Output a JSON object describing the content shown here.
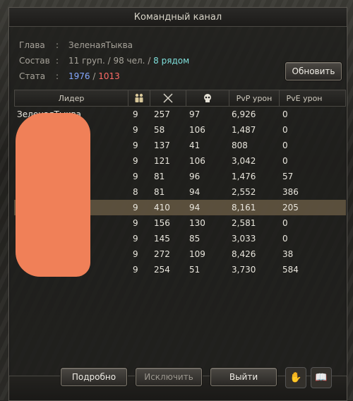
{
  "window": {
    "title": "Командный канал"
  },
  "info": {
    "leader_label": "Глава",
    "leader_value": "ЗеленаяТыква",
    "composition_label": "Состав",
    "composition_groups": "11 груп.",
    "composition_sep1": " / ",
    "composition_members": "98 чел.",
    "composition_sep2": " / ",
    "composition_nearby": "8 рядом",
    "stats_label": "Стата",
    "stats_kills": "1976",
    "stats_sep": " / ",
    "stats_deaths": "1013",
    "colon": ":"
  },
  "buttons": {
    "refresh": "Обновить",
    "details": "Подробно",
    "exclude": "Исключить",
    "exit": "Выйти"
  },
  "table": {
    "headers": {
      "leader": "Лидер",
      "group_icon": "group-icon",
      "kills_icon": "crossed-swords-icon",
      "deaths_icon": "skull-icon",
      "pvp": "PvP урон",
      "pve": "PvE урон"
    },
    "rows": [
      {
        "leader": "ЗеленаяТыква",
        "group": "9",
        "kills": "257",
        "deaths": "97",
        "pvp": "6,926",
        "pve": "0"
      },
      {
        "leader": "",
        "group": "9",
        "kills": "58",
        "deaths": "106",
        "pvp": "1,487",
        "pve": "0"
      },
      {
        "leader": "",
        "group": "9",
        "kills": "137",
        "deaths": "41",
        "pvp": "808",
        "pve": "0"
      },
      {
        "leader": "",
        "group": "9",
        "kills": "121",
        "deaths": "106",
        "pvp": "3,042",
        "pve": "0"
      },
      {
        "leader": "",
        "group": "9",
        "kills": "81",
        "deaths": "96",
        "pvp": "1,476",
        "pve": "57"
      },
      {
        "leader": "",
        "group": "8",
        "kills": "81",
        "deaths": "94",
        "pvp": "2,552",
        "pve": "386"
      },
      {
        "leader": "",
        "group": "9",
        "kills": "410",
        "deaths": "94",
        "pvp": "8,161",
        "pve": "205"
      },
      {
        "leader": "",
        "group": "9",
        "kills": "156",
        "deaths": "130",
        "pvp": "2,581",
        "pve": "0"
      },
      {
        "leader": "",
        "group": "9",
        "kills": "145",
        "deaths": "85",
        "pvp": "3,033",
        "pve": "0"
      },
      {
        "leader": "",
        "group": "9",
        "kills": "272",
        "deaths": "109",
        "pvp": "8,426",
        "pve": "38"
      },
      {
        "leader": "",
        "group": "9",
        "kills": "254",
        "deaths": "51",
        "pvp": "3,730",
        "pve": "584"
      }
    ]
  },
  "colors": {
    "accent_blue": "#86a8ff",
    "accent_red": "#ff6b66",
    "accent_teal": "#7fe0dc",
    "redaction": "#f08058"
  }
}
